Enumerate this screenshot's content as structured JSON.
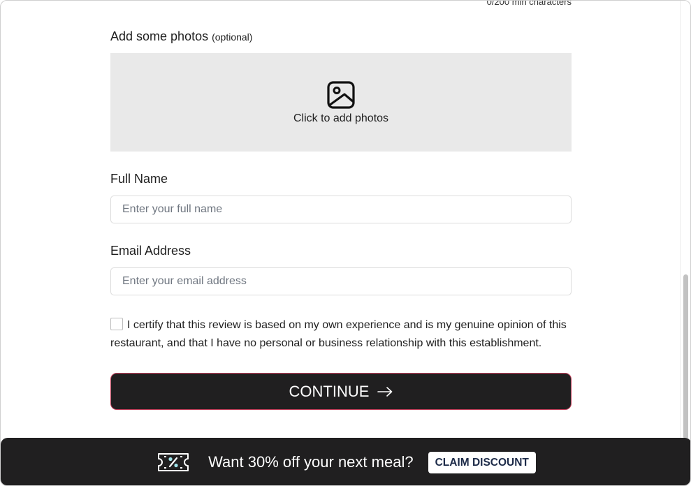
{
  "review_form": {
    "char_counter": "0/200 min characters",
    "photos": {
      "heading": "Add some photos",
      "optional_tag": "(optional)",
      "dropzone_label": "Click to add photos",
      "icon": "image-icon"
    },
    "full_name": {
      "label": "Full Name",
      "value": "",
      "placeholder": "Enter your full name"
    },
    "email": {
      "label": "Email Address",
      "value": "",
      "placeholder": "Enter your email address"
    },
    "certify": {
      "checked": false,
      "text": "I certify that this review is based on my own experience and is my genuine opinion of this restaurant, and that I have no personal or business relationship with this establishment."
    },
    "continue_button": {
      "label": "CONTINUE",
      "icon": "arrow-right-icon"
    }
  },
  "promo_bar": {
    "icon": "discount-ticket-icon",
    "text": "Want 30% off your next meal?",
    "cta_label": "CLAIM DISCOUNT"
  },
  "colors": {
    "button_bg": "#201f20",
    "button_border": "#c2405b",
    "dropzone_bg": "#e9e9e9",
    "cta_text": "#1c2a48",
    "ticket_accent": "#9fe3ea"
  }
}
